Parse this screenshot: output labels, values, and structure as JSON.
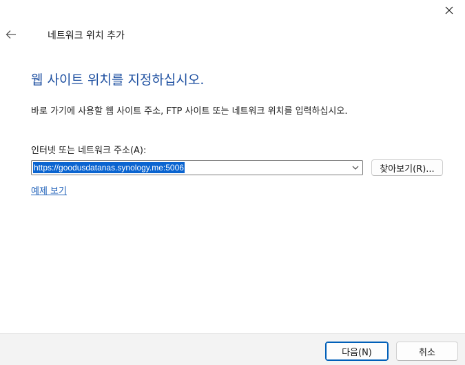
{
  "window": {
    "title": "네트워크 위치 추가"
  },
  "main": {
    "heading": "웹 사이트 위치를 지정하십시오.",
    "instruction": "바로 가기에 사용할 웹 사이트 주소, FTP 사이트 또는 네트워크 위치를 입력하십시오.",
    "address_label": "인터넷 또는 네트워크 주소(A):",
    "address_value": "https://goodusdatanas.synology.me:5006",
    "browse_label": "찾아보기(R)...",
    "example_link": "예제 보기"
  },
  "footer": {
    "next_label": "다음(N)",
    "cancel_label": "취소"
  },
  "icons": {
    "close": "close-icon",
    "back": "back-arrow-icon",
    "dropdown": "chevron-down-icon"
  },
  "colors": {
    "heading": "#1d4fa0",
    "link": "#1d5fb8",
    "selection": "#0a64d0",
    "primary_border": "#005fb8"
  }
}
